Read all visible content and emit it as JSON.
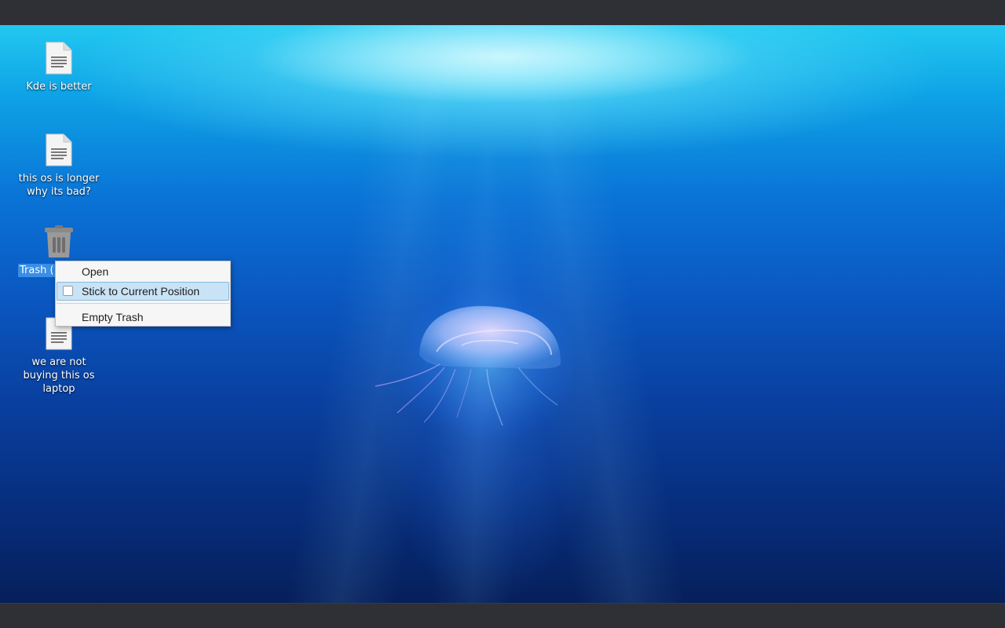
{
  "desktop": {
    "icons": [
      {
        "label": "Kde is better",
        "icon": "text-file-icon"
      },
      {
        "label": "this os is longer\nwhy its bad?",
        "icon": "text-file-icon"
      },
      {
        "label": "Trash (",
        "icon": "trash-icon",
        "selected": true
      },
      {
        "label": "we are not\nbuying this os\nlaptop",
        "icon": "text-file-icon"
      }
    ]
  },
  "context_menu": {
    "items": [
      {
        "label": "Open"
      },
      {
        "label": "Stick to Current Position",
        "checked": false,
        "highlighted": true
      },
      {
        "label": "Empty Trash"
      }
    ]
  },
  "colors": {
    "selection": "#3a8ee6",
    "menu_highlight": "#c9e3f6",
    "panel": "#2f2f36"
  }
}
